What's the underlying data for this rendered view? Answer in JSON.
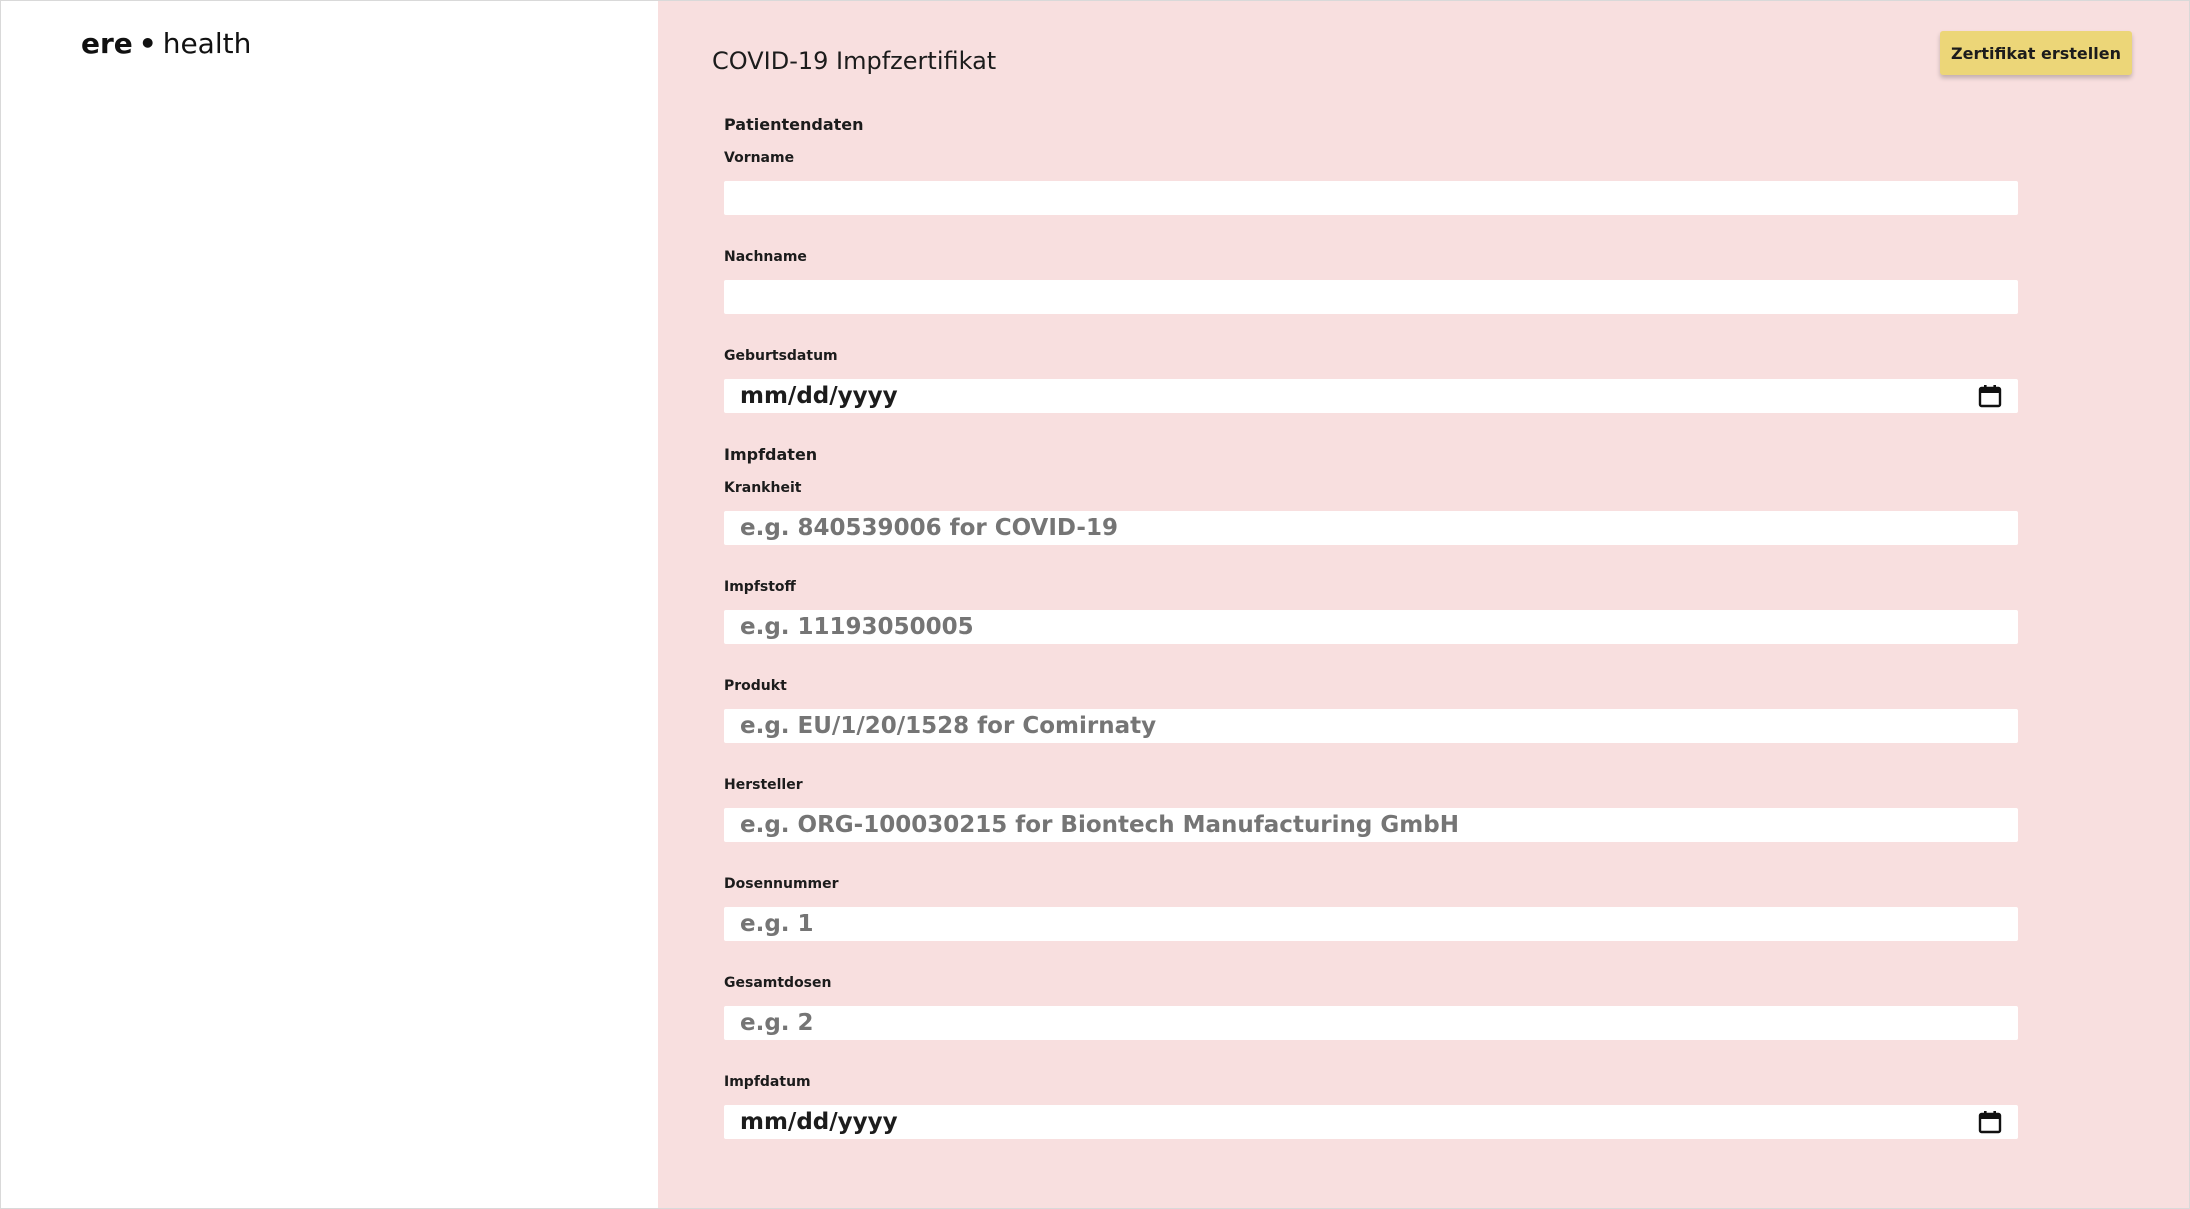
{
  "brand": {
    "name_strong": "ere",
    "separator": "•",
    "name_light": "health"
  },
  "header": {
    "title": "COVID-19 Impfzertifikat",
    "create_button_label": "Zertifikat erstellen"
  },
  "colors": {
    "main_background": "#f8dfdf",
    "button_background": "#ecd678",
    "sidebar_background": "#ffffff",
    "input_background": "#ffffff"
  },
  "patient_section": {
    "heading": "Patientendaten",
    "vorname": {
      "label": "Vorname",
      "value": "",
      "placeholder": ""
    },
    "nachname": {
      "label": "Nachname",
      "value": "",
      "placeholder": ""
    },
    "geburtsdatum": {
      "label": "Geburtsdatum",
      "format": "mm/dd/yyyy",
      "icon": "calendar-icon"
    }
  },
  "vaccination_section": {
    "heading": "Impfdaten",
    "krankheit": {
      "label": "Krankheit",
      "value": "",
      "placeholder": "e.g. 840539006 for COVID-19"
    },
    "impfstoff": {
      "label": "Impfstoff",
      "value": "",
      "placeholder": "e.g. 11193050005"
    },
    "produkt": {
      "label": "Produkt",
      "value": "",
      "placeholder": "e.g. EU/1/20/1528 for Comirnaty"
    },
    "hersteller": {
      "label": "Hersteller",
      "value": "",
      "placeholder": "e.g. ORG-100030215 for Biontech Manufacturing GmbH"
    },
    "dosennummer": {
      "label": "Dosennummer",
      "value": "",
      "placeholder": "e.g. 1"
    },
    "gesamtdosen": {
      "label": "Gesamtdosen",
      "value": "",
      "placeholder": "e.g. 2"
    },
    "impfdatum": {
      "label": "Impfdatum",
      "format": "mm/dd/yyyy",
      "icon": "calendar-icon"
    }
  }
}
